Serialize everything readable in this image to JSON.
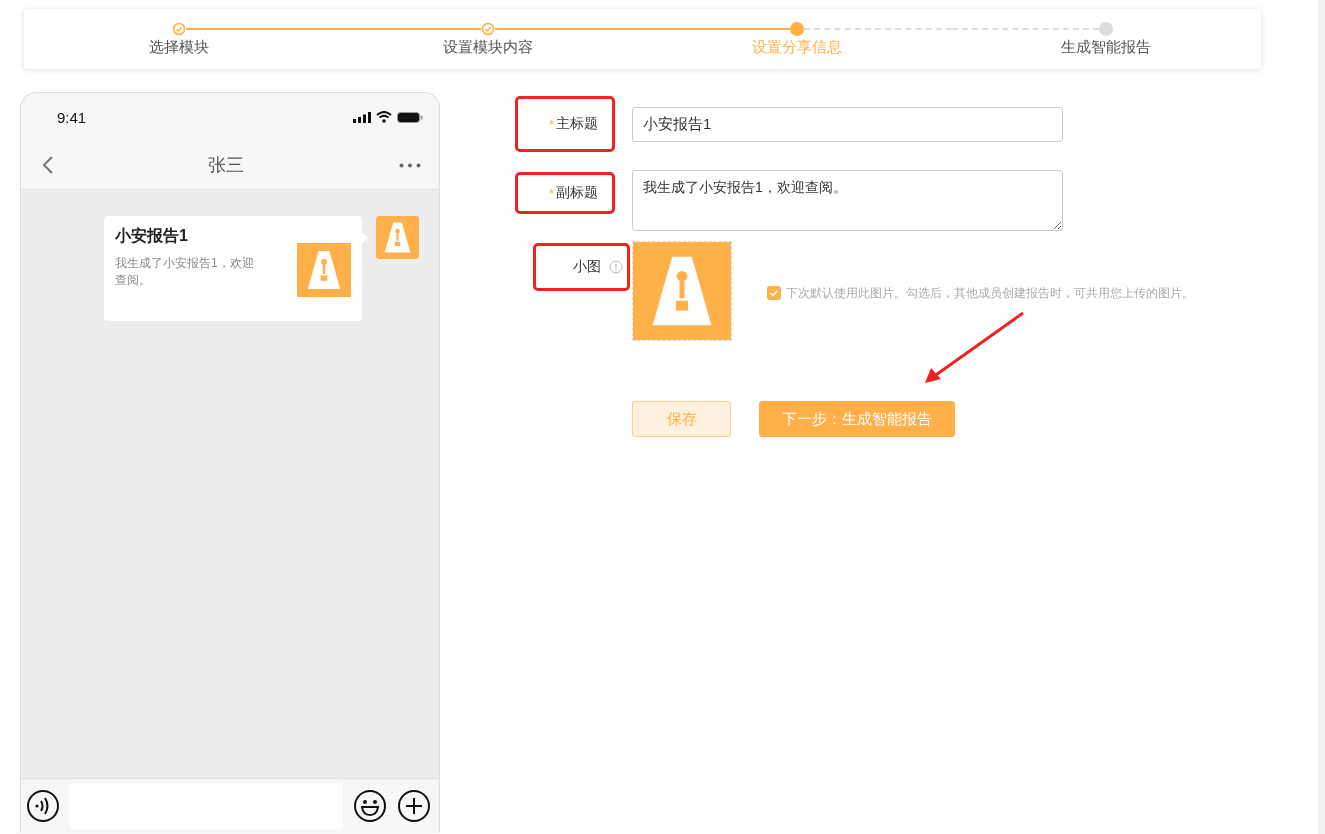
{
  "stepper": {
    "steps": [
      {
        "label": "选择模块",
        "completed": true,
        "selected": false
      },
      {
        "label": "设置模块内容",
        "completed": true,
        "selected": false
      },
      {
        "label": "设置分享信息",
        "completed": false,
        "selected": true
      },
      {
        "label": "生成智能报告",
        "completed": false,
        "selected": false
      }
    ]
  },
  "phone": {
    "time": "9:41",
    "chat_title": "张三",
    "message": {
      "title": "小安报告1",
      "text": "我生成了小安报告1，欢迎查阅。"
    }
  },
  "form": {
    "fields": [
      {
        "kind": "input",
        "required_mark": "*",
        "label": "主标题",
        "value": "小安报告1",
        "highlighted": true
      },
      {
        "kind": "textarea",
        "required_mark": "*",
        "label": "副标题",
        "value": "我生成了小安报告1，欢迎查阅。",
        "highlighted": true
      },
      {
        "kind": "image",
        "label": "小图",
        "highlighted": true,
        "checkbox": {
          "label": "下次默认使用此图片。勾选后，其他成员创建报告时，可共用您上传的图片。",
          "checked": true
        }
      }
    ],
    "buttons": [
      {
        "label": "保存",
        "kind": "secondary"
      },
      {
        "label": "下一步：生成智能报告",
        "kind": "primary"
      }
    ]
  }
}
